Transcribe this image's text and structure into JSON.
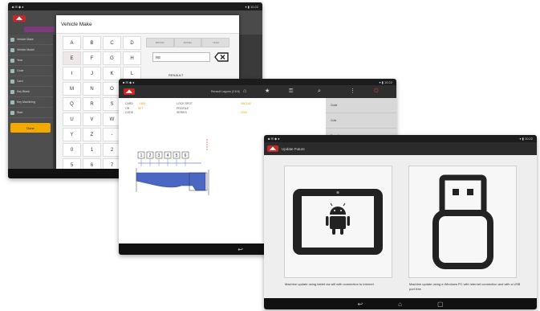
{
  "tablet1": {
    "dialog_title": "Vehicle Make",
    "keys": [
      "A",
      "B",
      "C",
      "D",
      "E",
      "F",
      "G",
      "H",
      "I",
      "J",
      "K",
      "L",
      "M",
      "N",
      "O",
      "P",
      "Q",
      "R",
      "S",
      "T",
      "U",
      "V",
      "W",
      "X",
      "Y",
      "Z",
      "-",
      "*",
      "0",
      "1",
      "2",
      "3",
      "5",
      "6",
      "7",
      "8"
    ],
    "tabs": [
      "BRAND",
      "MODEL",
      "YEAR"
    ],
    "make_value": "RE",
    "result": "RENAULT",
    "sidebar_items": [
      "Vehicle Make",
      "Vehicle Model",
      "Year",
      "Code",
      "Card",
      "Key Blank",
      "Key Machining",
      "Start"
    ],
    "search_label": "Search",
    "start_button": "Done"
  },
  "tablet2": {
    "title": "Renault Laguna (2.8.6)",
    "labels": [
      "CARD",
      "OR",
      "CODE"
    ],
    "label_values": [
      "1800",
      "SET"
    ],
    "labels2": [
      "LOCK SPOT",
      "PROFILE",
      "SERIES"
    ],
    "value2": "VAC102",
    "series_value": "1234",
    "cuts": [
      "1",
      "2",
      "3",
      "4",
      "5",
      "6"
    ],
    "panel_items": [
      "Code",
      "Cuts",
      "Decoding"
    ]
  },
  "tablet3": {
    "title": "Update Future",
    "option_tablet": "Machine update using tablet via wifi with connection to internet",
    "option_pc": "Machine update using a Windows PC with internet connection and with a USB port free"
  },
  "colors": {
    "brand": "#c62828",
    "accent": "#e0a000",
    "dark": "#2b2b2b"
  }
}
